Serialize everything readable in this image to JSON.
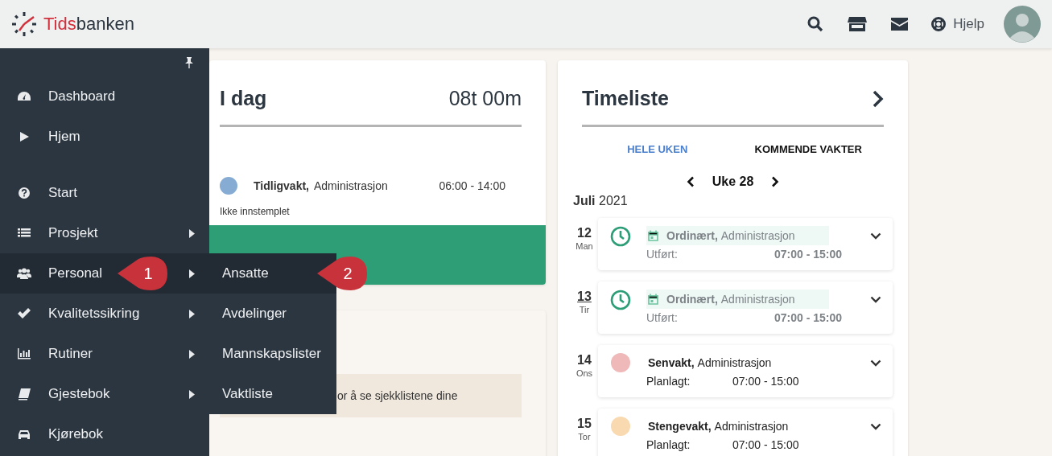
{
  "header": {
    "logo": {
      "accent": "Tids",
      "rest": "banken"
    },
    "help_link": "Hjelp"
  },
  "sidebar": {
    "groups": [
      {
        "items": [
          {
            "label": "Dashboard",
            "selected": false,
            "submenu": false
          },
          {
            "label": "Hjem",
            "selected": false,
            "submenu": false
          }
        ]
      },
      {
        "items": [
          {
            "label": "Start",
            "selected": false,
            "submenu": false
          },
          {
            "label": "Prosjekt",
            "selected": false,
            "submenu": true
          },
          {
            "label": "Personal",
            "selected": true,
            "submenu": true,
            "callout": "1"
          },
          {
            "label": "Kvalitetssikring",
            "selected": false,
            "submenu": true
          },
          {
            "label": "Rutiner",
            "selected": false,
            "submenu": true
          },
          {
            "label": "Gjestebok",
            "selected": false,
            "submenu": true
          },
          {
            "label": "Kjørebok",
            "selected": false,
            "submenu": false
          }
        ]
      }
    ]
  },
  "submenu": {
    "items": [
      {
        "label": "Ansatte",
        "selected": true,
        "callout": "2"
      },
      {
        "label": "Avdelinger",
        "selected": false
      },
      {
        "label": "Mannskapslister",
        "selected": false
      },
      {
        "label": "Vaktliste",
        "selected": false
      }
    ]
  },
  "today_card": {
    "title": "I dag",
    "total": "08t 00m",
    "shift": {
      "color": "#86acd3",
      "name": "Tidligvakt,",
      "department": "Administrasjon",
      "time": "06:00 - 14:00"
    },
    "status": "Ikke innstemplet"
  },
  "checklist_card": {
    "message": "or å se sjekklistene dine"
  },
  "timesheet": {
    "title": "Timeliste",
    "tabs": [
      {
        "label": "HELE UKEN",
        "selected": true
      },
      {
        "label": "KOMMENDE VAKTER",
        "selected": false
      }
    ],
    "week": "Uke 28",
    "month": "**Juli** 2021",
    "days": [
      {
        "date": "12",
        "weekday": "Man",
        "today": false,
        "kind": "worked",
        "name": "Ordinært,",
        "department": "Administrasjon",
        "label": "Utført:",
        "time": "07:00 - 15:00"
      },
      {
        "date": "13",
        "weekday": "Tir",
        "today": true,
        "kind": "worked",
        "name": "Ordinært,",
        "department": "Administrasjon",
        "label": "Utført:",
        "time": "07:00 - 15:00"
      },
      {
        "date": "14",
        "weekday": "Ons",
        "today": false,
        "kind": "planned",
        "color": "#efb9b9",
        "name": "Senvakt,",
        "department": "Administrasjon",
        "label": "Planlagt:",
        "time": "07:00 - 15:00"
      },
      {
        "date": "15",
        "weekday": "Tor",
        "today": false,
        "kind": "planned",
        "color": "#f8d9b0",
        "name": "Stengevakt,",
        "department": "Administrasjon",
        "label": "Planlagt:",
        "time": "07:00 - 15:00"
      }
    ]
  }
}
